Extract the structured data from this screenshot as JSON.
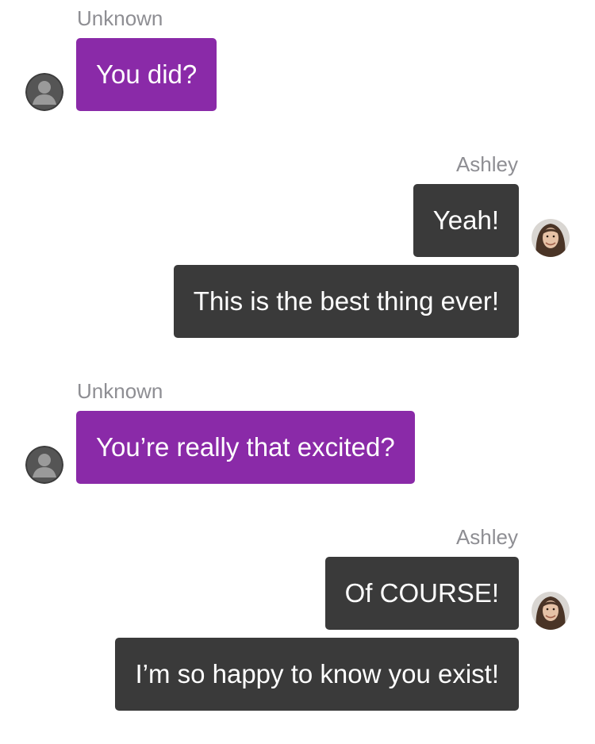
{
  "messages": [
    {
      "sender": "Unknown",
      "direction": "incoming",
      "avatar_icon": "default-user-avatar-icon",
      "bubbles": [
        "You did?"
      ]
    },
    {
      "sender": "Ashley",
      "direction": "outgoing",
      "avatar_icon": "ashley-photo-avatar",
      "bubbles": [
        "Yeah!",
        "This is the best thing ever!"
      ]
    },
    {
      "sender": "Unknown",
      "direction": "incoming",
      "avatar_icon": "default-user-avatar-icon",
      "bubbles": [
        "You’re really that excited?"
      ]
    },
    {
      "sender": "Ashley",
      "direction": "outgoing",
      "avatar_icon": "ashley-photo-avatar",
      "bubbles": [
        "Of COURSE!",
        "I’m so happy to know you exist!"
      ]
    }
  ],
  "colors": {
    "incoming_bubble": "#8a2aa8",
    "outgoing_bubble": "#3a3a3a",
    "sender_label": "#8e8e93",
    "bubble_text": "#ffffff"
  }
}
